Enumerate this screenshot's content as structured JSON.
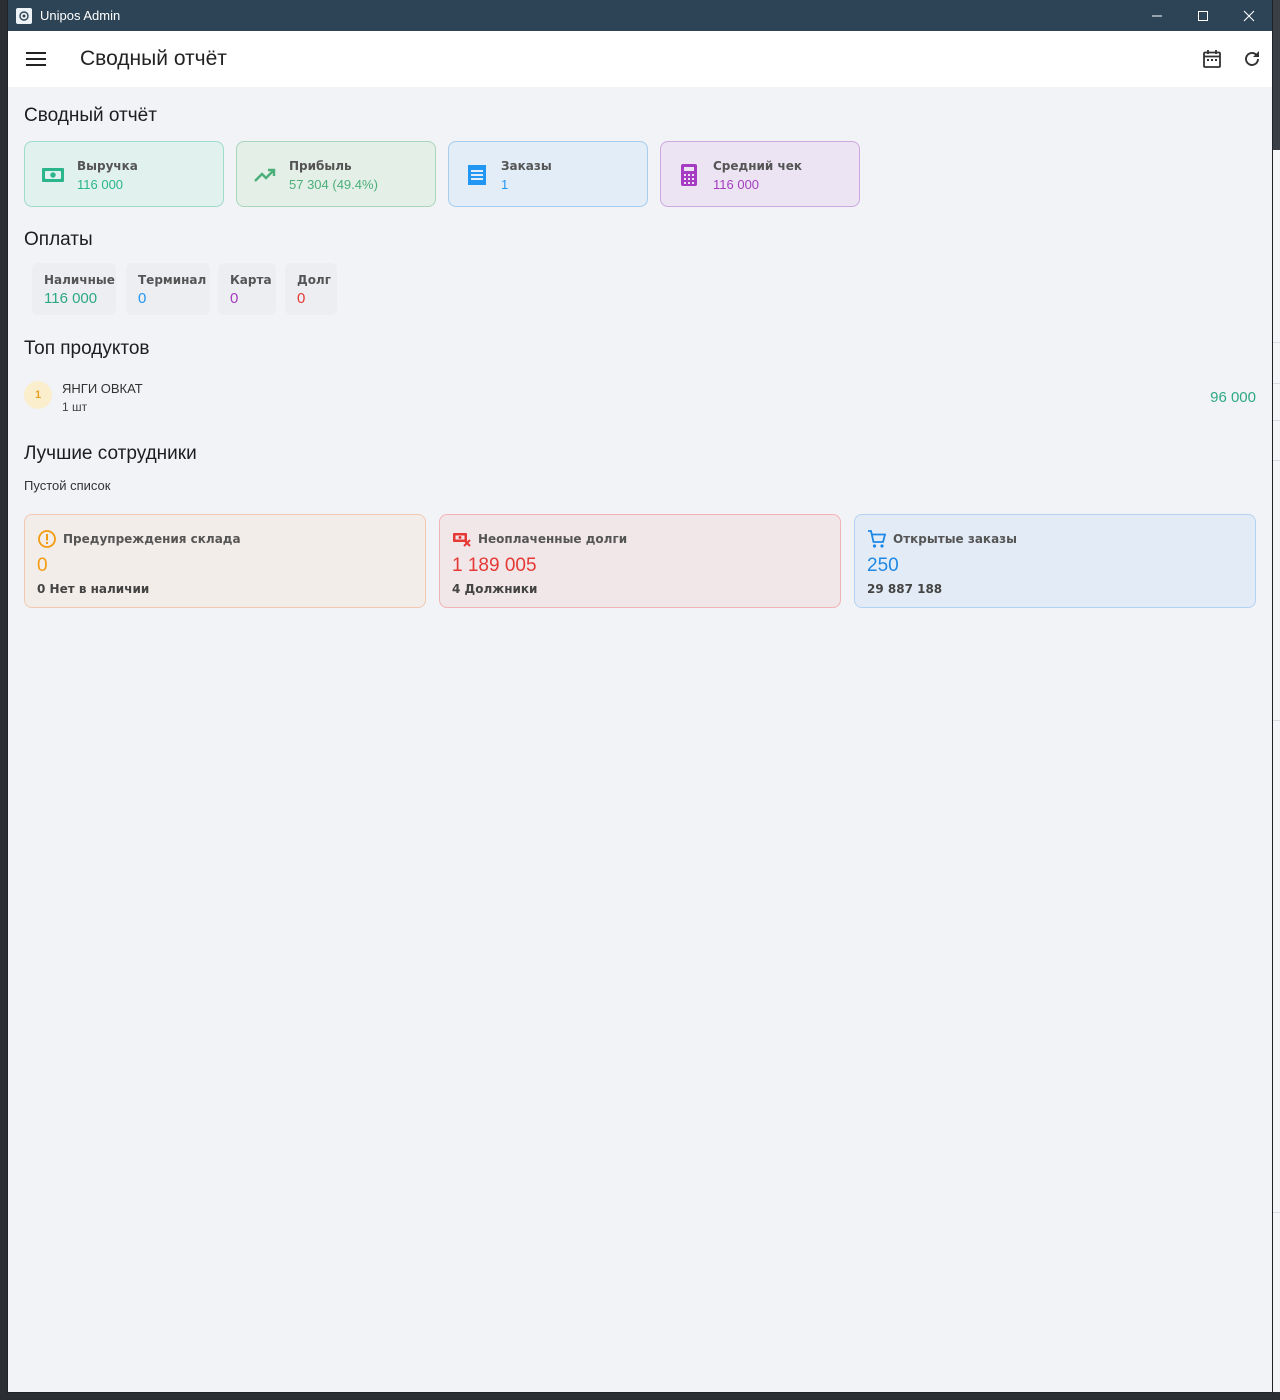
{
  "window": {
    "title": "Unipos Admin"
  },
  "appbar": {
    "title": "Сводный отчёт"
  },
  "summary": {
    "title": "Сводный отчёт",
    "cards": [
      {
        "label": "Выручка",
        "value": "116 000",
        "icon": "cash-icon",
        "color": "#2ab58a"
      },
      {
        "label": "Прибыль",
        "value": "57 304 (49.4%)",
        "icon": "trending-up-icon",
        "color": "#4caf7a"
      },
      {
        "label": "Заказы",
        "value": "1",
        "icon": "receipt-icon",
        "color": "#2196f3"
      },
      {
        "label": "Средний чек",
        "value": "116 000",
        "icon": "calculator-icon",
        "color": "#a63cc1"
      }
    ]
  },
  "payments": {
    "title": "Оплаты",
    "items": [
      {
        "label": "Наличные",
        "value": "116 000",
        "color": "#2ea882"
      },
      {
        "label": "Терминал",
        "value": "0",
        "color": "#2196f3"
      },
      {
        "label": "Карта",
        "value": "0",
        "color": "#a63cc1"
      },
      {
        "label": "Долг",
        "value": "0",
        "color": "#e53935"
      }
    ]
  },
  "top_products": {
    "title": "Топ продуктов",
    "items": [
      {
        "rank": "1",
        "name": "ЯНГИ ОВКАТ",
        "qty": "1 шт",
        "sum": "96 000"
      }
    ]
  },
  "best_employees": {
    "title": "Лучшие сотрудники",
    "empty_text": "Пустой список"
  },
  "alerts": [
    {
      "label": "Предупреждения склада",
      "value": "0",
      "sub": "0 Нет в наличии",
      "icon": "warning-icon",
      "color": "#f39c12"
    },
    {
      "label": "Неоплаченные долги",
      "value": "1 189 005",
      "sub": "4 Должники",
      "icon": "money-off-icon",
      "color": "#e53935"
    },
    {
      "label": "Открытые заказы",
      "value": "250",
      "sub": "29 887 188",
      "icon": "cart-icon",
      "color": "#1e88e5"
    }
  ]
}
